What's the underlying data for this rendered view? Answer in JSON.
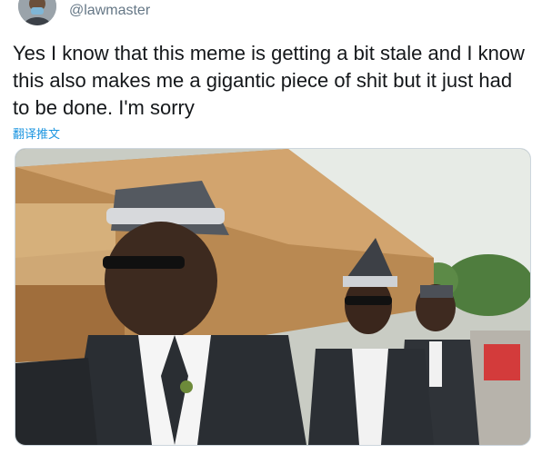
{
  "tweet": {
    "handle": "@lawmaster",
    "text": "Yes I know that this meme is getting a bit stale and I know this also makes me a gigantic piece of shit but it just had to be done. I'm sorry",
    "translate_label": "翻译推文"
  },
  "media": {
    "type": "video-still"
  },
  "icons": {
    "avatar": "avatar-image"
  },
  "colors": {
    "text": "#14171a",
    "handle": "#657786",
    "link": "#1b95e0"
  }
}
